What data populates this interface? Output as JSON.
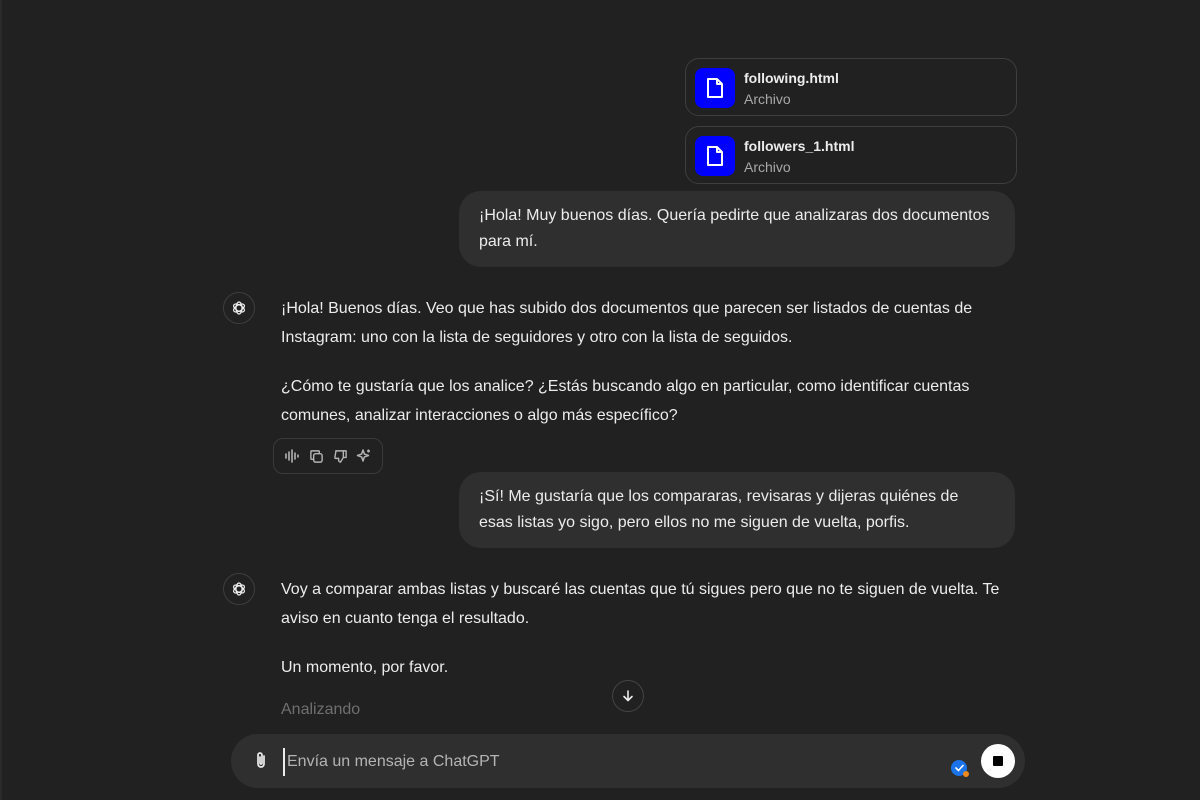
{
  "attachments": [
    {
      "name": "following.html",
      "type": "Archivo"
    },
    {
      "name": "followers_1.html",
      "type": "Archivo"
    }
  ],
  "messages": {
    "user_1": "¡Hola! Muy buenos días. Quería pedirte que analizaras dos documentos para mí.",
    "assistant_1": {
      "p1": "¡Hola! Buenos días. Veo que has subido dos documentos que parecen ser listados de cuentas de Instagram: uno con la lista de seguidores y otro con la lista de seguidos.",
      "p2": "¿Cómo te gustaría que los analice? ¿Estás buscando algo en particular, como identificar cuentas comunes, analizar interacciones o algo más específico?"
    },
    "user_2": "¡Sí! Me gustaría que los compararas, revisaras y dijeras quiénes de esas listas yo sigo, pero ellos no me siguen de vuelta, porfis.",
    "assistant_2": {
      "p1": "Voy a comparar ambas listas y buscaré las cuentas que tú sigues pero que no te siguen de vuelta. Te aviso en cuanto tenga el resultado.",
      "p2": "Un momento, por favor.",
      "status": "Analizando"
    }
  },
  "action_icons": [
    "read-aloud-icon",
    "copy-icon",
    "thumbs-down-icon",
    "regenerate-sparkle-icon"
  ],
  "composer": {
    "placeholder": "Envía un mensaje a ChatGPT"
  },
  "colors": {
    "background": "#212121",
    "bubble": "#2f2f2f",
    "file_icon": "#0000ff",
    "status_text": "#6f6f6f"
  }
}
